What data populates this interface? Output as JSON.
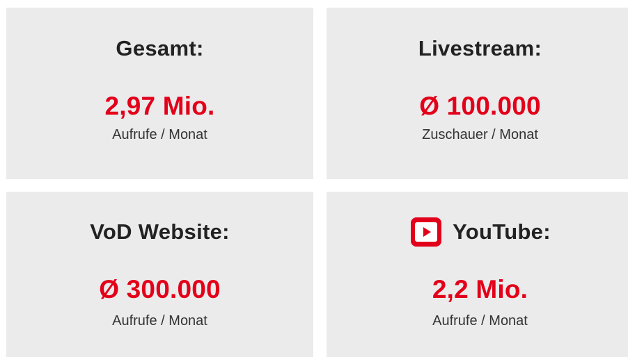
{
  "cards": [
    {
      "title": "Gesamt:",
      "value": "2,97 Mio.",
      "subtitle": "Aufrufe / Monat"
    },
    {
      "title": "Livestream:",
      "value": "Ø 100.000",
      "subtitle": "Zuschauer / Monat"
    },
    {
      "title": "VoD Website:",
      "value": "Ø 300.000",
      "subtitle": "Aufrufe / Monat"
    },
    {
      "title": "YouTube:",
      "value": "2,2 Mio.",
      "subtitle": "Aufrufe / Monat",
      "icon": "youtube-icon"
    }
  ],
  "colors": {
    "card_background": "#ebebeb",
    "accent": "#e2001a",
    "title_text": "#222222",
    "subtitle_text": "#333333"
  }
}
